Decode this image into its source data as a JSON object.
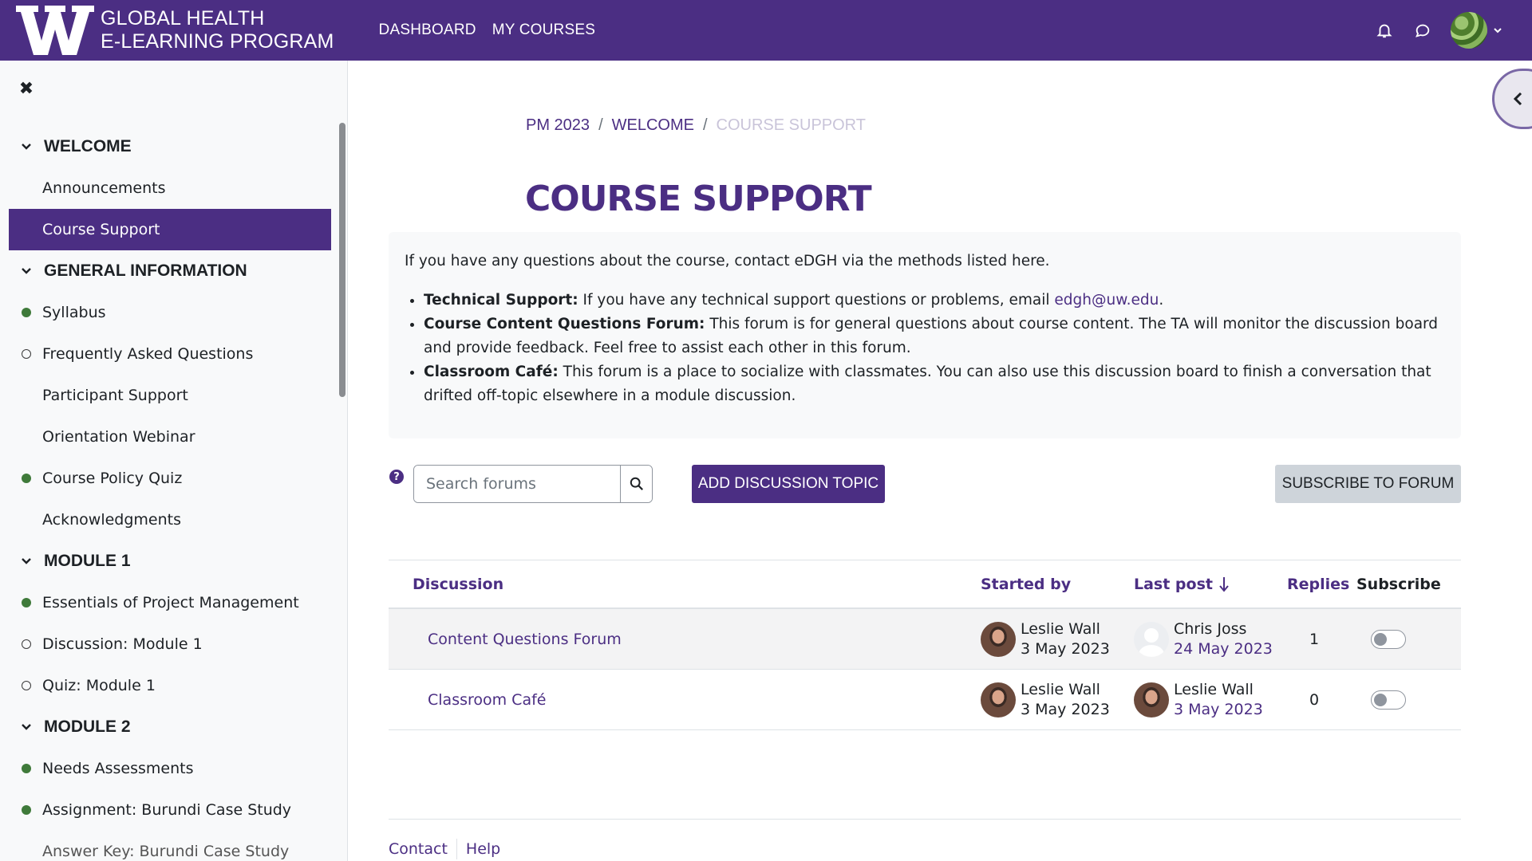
{
  "header": {
    "logo_line1": "GLOBAL HEALTH",
    "logo_line2": "E-LEARNING PROGRAM",
    "nav": [
      "DASHBOARD",
      "MY COURSES"
    ],
    "brand_color": "#4b2e83"
  },
  "drawer": {
    "sections": [
      {
        "title": "WELCOME",
        "items": [
          {
            "label": "Announcements",
            "status": "none"
          },
          {
            "label": "Course Support",
            "status": "none",
            "active": true
          }
        ]
      },
      {
        "title": "GENERAL INFORMATION",
        "items": [
          {
            "label": "Syllabus",
            "status": "done"
          },
          {
            "label": "Frequently Asked Questions",
            "status": "todo"
          },
          {
            "label": "Participant Support",
            "status": "none"
          },
          {
            "label": "Orientation Webinar",
            "status": "none"
          },
          {
            "label": "Course Policy Quiz",
            "status": "done"
          },
          {
            "label": "Acknowledgments",
            "status": "none"
          }
        ]
      },
      {
        "title": "MODULE 1",
        "items": [
          {
            "label": "Essentials of Project Management",
            "status": "done"
          },
          {
            "label": "Discussion: Module 1",
            "status": "todo"
          },
          {
            "label": "Quiz: Module 1",
            "status": "todo"
          }
        ]
      },
      {
        "title": "MODULE 2",
        "items": [
          {
            "label": "Needs Assessments",
            "status": "done"
          },
          {
            "label": "Assignment: Burundi Case Study",
            "status": "done"
          },
          {
            "label": "Answer Key: Burundi Case Study",
            "status": "none",
            "faded": true
          }
        ]
      }
    ]
  },
  "breadcrumb": [
    "PM 2023",
    "WELCOME",
    "COURSE SUPPORT"
  ],
  "page_title": "COURSE SUPPORT",
  "intro": {
    "lead": "If you have any questions about the course, contact eDGH via the methods listed here.",
    "items": [
      {
        "title": "Technical Support:",
        "text": "If you have any technical support questions or problems, email ",
        "link": "edgh@uw.edu",
        "after": "."
      },
      {
        "title": "Course Content Questions Forum:",
        "text": "This forum is for general questions about course content. The TA will monitor the discussion board and provide feedback. Feel free to assist each other in this forum."
      },
      {
        "title": "Classroom Café:",
        "text": "This forum is a place to socialize with classmates. You can also use this discussion board to finish a conversation that drifted off-topic elsewhere in a module discussion."
      }
    ]
  },
  "controls": {
    "search_placeholder": "Search forums",
    "add_topic": "ADD DISCUSSION TOPIC",
    "subscribe": "SUBSCRIBE TO FORUM"
  },
  "table": {
    "headers": {
      "discussion": "Discussion",
      "started_by": "Started by",
      "last_post": "Last post",
      "replies": "Replies",
      "subscribe": "Subscribe"
    },
    "rows": [
      {
        "topic": "Content Questions Forum",
        "started_name": "Leslie Wall",
        "started_date": "3 May 2023",
        "last_name": "Chris Joss",
        "last_date": "24 May 2023",
        "replies": "1",
        "subscribed": false
      },
      {
        "topic": "Classroom Café",
        "started_name": "Leslie Wall",
        "started_date": "3 May 2023",
        "last_name": "Leslie Wall",
        "last_date": "3 May 2023",
        "replies": "0",
        "subscribed": false
      }
    ]
  },
  "footer": [
    "Contact",
    "Help"
  ]
}
